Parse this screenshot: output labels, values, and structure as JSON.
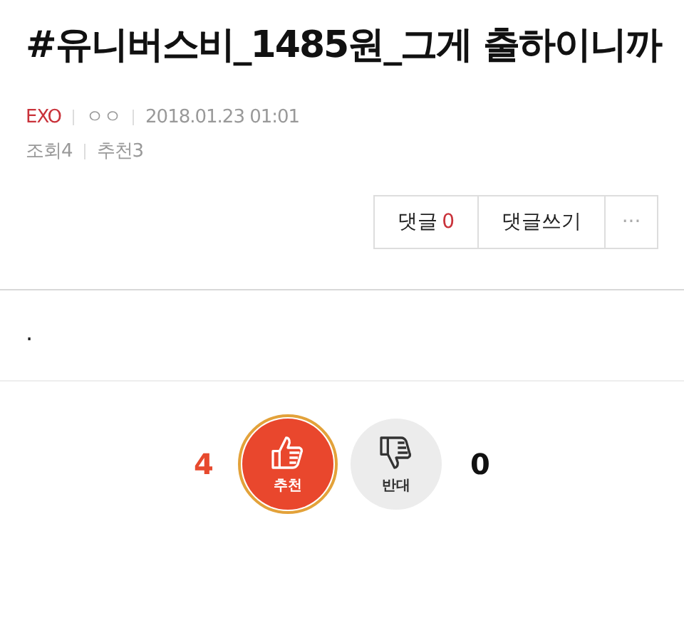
{
  "post": {
    "title": "#유니버스비_1485원_그게 출하이니까",
    "meta": [
      {
        "kind": "category",
        "text": "EXO"
      },
      {
        "kind": "text",
        "text": "ㅇㅇ"
      },
      {
        "kind": "text",
        "text": "2018.01.23 01:01"
      }
    ],
    "stats": [
      "조회4",
      "추천3"
    ],
    "actions": [
      {
        "kind": "count",
        "label": "댓글",
        "count": "0"
      },
      {
        "kind": "plain",
        "label": "댓글쓰기"
      },
      {
        "kind": "more",
        "label": "···"
      }
    ],
    "body": ".",
    "votes": [
      {
        "kind": "up",
        "count": "4",
        "label": "추천",
        "selected": true
      },
      {
        "kind": "down",
        "label": "반대",
        "count": "0",
        "selected": false
      }
    ]
  }
}
